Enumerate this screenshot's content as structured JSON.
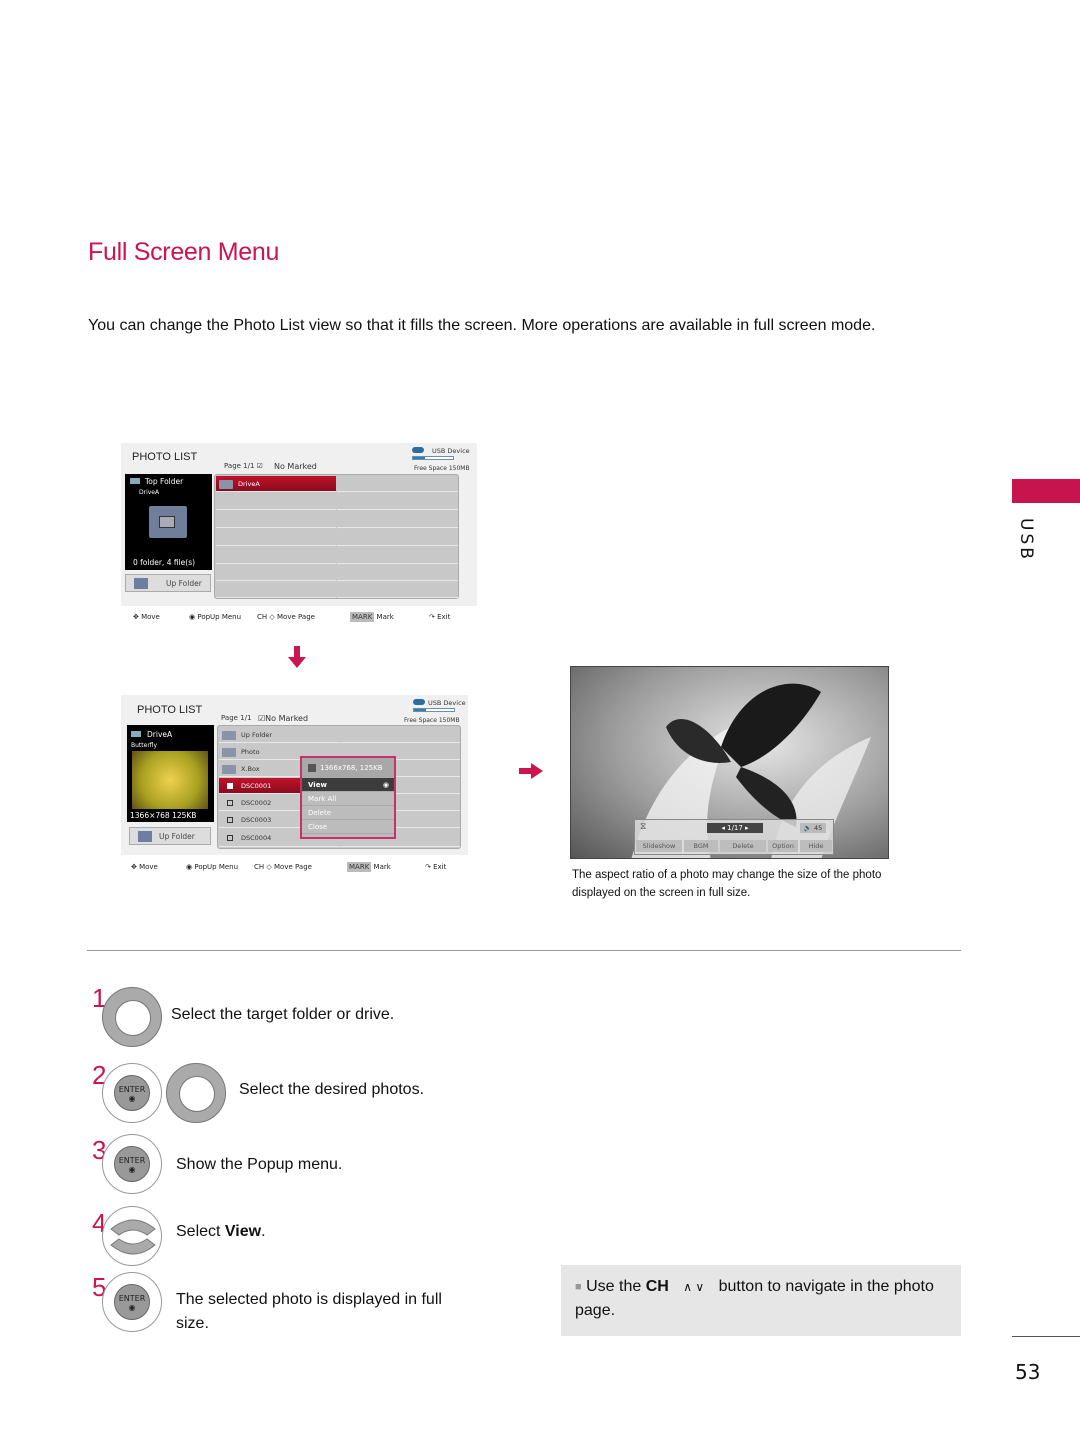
{
  "page": {
    "title": "Full Screen Menu",
    "intro": "You can change the Photo List view so that it fills the screen. More operations are available in full screen mode.",
    "side_tab": "USB",
    "page_number": "53",
    "accent_color": "#cc1450"
  },
  "panel1": {
    "title": "PHOTO LIST",
    "page_info": "Page 1/1 ☑",
    "marked": "No Marked",
    "usb_label": "USB Device",
    "usage_fraction": 0.3,
    "free_space": "Free Space 150MB",
    "preview_heading": "Top Folder",
    "preview_sub": "DriveA",
    "preview_count": "0 folder, 4 file(s)",
    "up_folder": "Up Folder",
    "items": [
      {
        "label": "DriveA",
        "selected": true
      }
    ],
    "footer": {
      "move": "Move",
      "popup": "PopUp Menu",
      "ch": "CH",
      "move_page": "Move Page",
      "mark_key": "MARK",
      "mark": "Mark",
      "exit": "Exit"
    }
  },
  "panel2": {
    "title": "PHOTO LIST",
    "page_info": "Page 1/1",
    "marked": "☑No Marked",
    "usb_label": "USB Device",
    "usage_fraction": 0.3,
    "free_space": "Free Space 150MB",
    "preview_heading": "DriveA",
    "preview_sub": "Butterfly",
    "preview_info": "1366×768  125KB",
    "up_folder": "Up Folder",
    "items": [
      {
        "label": "Up Folder",
        "type": "up"
      },
      {
        "label": "Photo",
        "type": "folder"
      },
      {
        "label": "X.Box",
        "type": "folder"
      },
      {
        "label": "DSC0001",
        "type": "file",
        "selected": true
      },
      {
        "label": "DSC0002",
        "type": "file"
      },
      {
        "label": "DSC0003",
        "type": "file"
      },
      {
        "label": "DSC0004",
        "type": "file"
      }
    ],
    "popup": {
      "info": "1366x768, 125KB",
      "items": [
        "View",
        "Mark All",
        "Delete",
        "Close"
      ],
      "active": "View"
    },
    "footer": {
      "move": "Move",
      "popup": "PopUp Menu",
      "ch": "CH",
      "move_page": "Move Page",
      "mark_key": "MARK",
      "mark": "Mark",
      "exit": "Exit"
    }
  },
  "fullscreen": {
    "page_counter": "1/17",
    "volume": "45",
    "buttons": [
      "Slideshow",
      "BGM",
      "Delete",
      "Option",
      "Hide"
    ],
    "caption": "The aspect ratio of a photo may change the size of the photo displayed on the screen in full size."
  },
  "steps": [
    {
      "num": "1",
      "text": "Select the target folder or drive."
    },
    {
      "num": "2",
      "text": "Select the desired photos."
    },
    {
      "num": "3",
      "text": "Show the Popup menu."
    },
    {
      "num": "4",
      "text_prefix": "Select ",
      "text_bold": "View",
      "text_suffix": "."
    },
    {
      "num": "5",
      "text": "The selected photo is displayed in full size."
    }
  ],
  "note": {
    "prefix": "Use the ",
    "bold": "CH",
    "arrows": "∧ ∨",
    "suffix": " button to navigate in the photo page."
  },
  "enter_label": "ENTER"
}
